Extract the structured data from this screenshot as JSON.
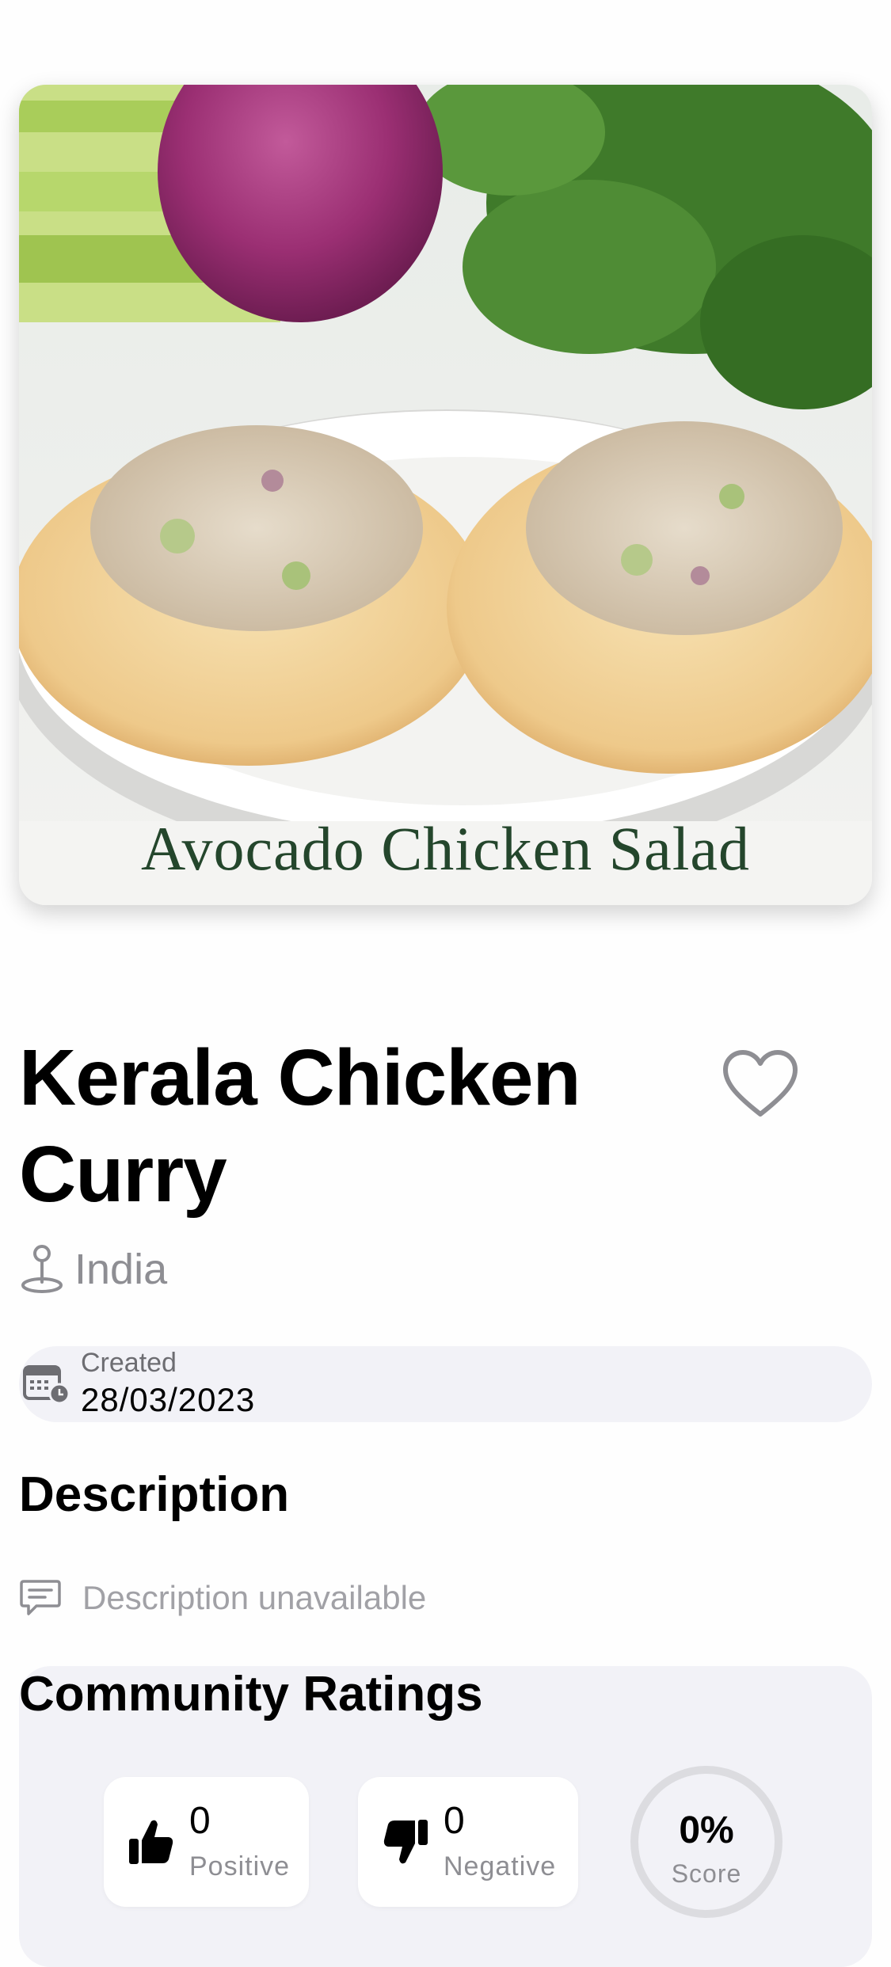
{
  "hero": {
    "caption": "Avocado Chicken Salad"
  },
  "recipe": {
    "title": "Kerala Chicken Curry",
    "location": "India",
    "created_label": "Created",
    "created_date": "28/03/2023"
  },
  "description": {
    "heading": "Description",
    "text": "Description unavailable"
  },
  "ratings": {
    "heading": "Community Ratings",
    "positive_count": "0",
    "positive_label": "Positive",
    "negative_count": "0",
    "negative_label": "Negative",
    "score_value": "0%",
    "score_label": "Score"
  },
  "icons": {
    "favorite": "heart-outline-icon",
    "location": "map-pin-icon",
    "calendar": "calendar-clock-icon",
    "description": "speech-bubble-icon",
    "positive": "thumbs-up-icon",
    "negative": "thumbs-down-icon"
  }
}
